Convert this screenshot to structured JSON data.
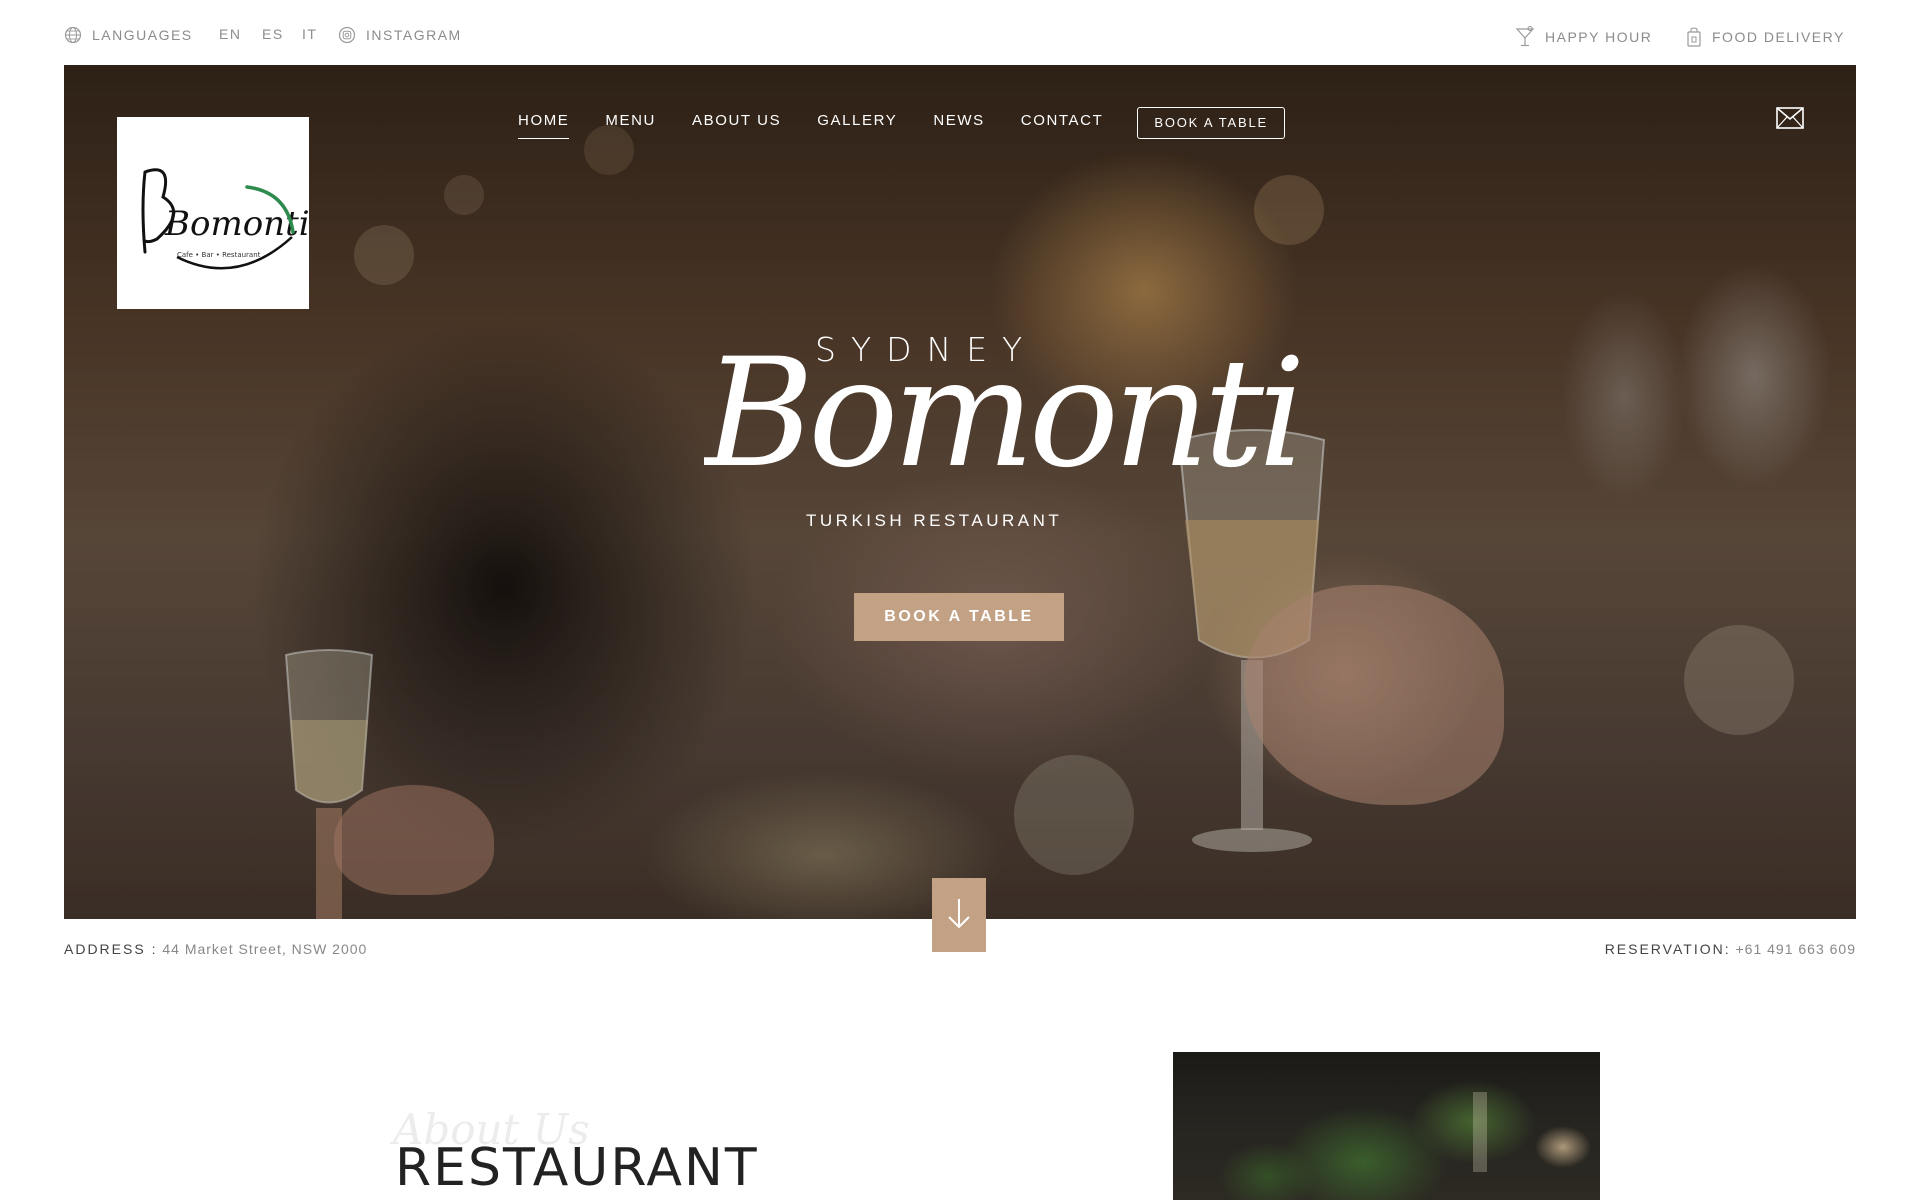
{
  "topbar": {
    "left": [
      {
        "icon": "globe-icon",
        "label": "LANGUAGES"
      },
      {
        "label": "EN"
      },
      {
        "label": "ES"
      },
      {
        "label": "IT"
      },
      {
        "icon": "instagram-icon",
        "label": "INSTAGRAM"
      }
    ],
    "right": [
      {
        "icon": "cocktail-icon",
        "label": "HAPPY HOUR"
      },
      {
        "icon": "delivery-bag-icon",
        "label": "FOOD DELIVERY"
      }
    ]
  },
  "logo": {
    "text": "Bomonti",
    "subtext": "Cafe • Bar • Restaurant"
  },
  "nav": {
    "items": [
      "HOME",
      "MENU",
      "ABOUT US",
      "GALLERY",
      "NEWS",
      "CONTACT"
    ],
    "active": "HOME",
    "book_label": "BOOK A TABLE",
    "mail_icon": "envelope-icon"
  },
  "hero": {
    "kicker": "SYDNEY",
    "brand": "Bomonti",
    "tagline": "TURKISH RESTAURANT",
    "cta": "BOOK A TABLE",
    "scroll_icon": "arrow-down-icon"
  },
  "info": {
    "address_label": "ADDRESS :",
    "address_value": "44 Market Street, NSW 2000",
    "reservation_label": "RESERVATION:",
    "reservation_value": "+61 491 663 609"
  },
  "about": {
    "script": "About Us",
    "title": "RESTAURANT"
  },
  "colors": {
    "accent": "#c3a185",
    "topbar_text": "#8c8c8c",
    "heading": "#222222"
  }
}
